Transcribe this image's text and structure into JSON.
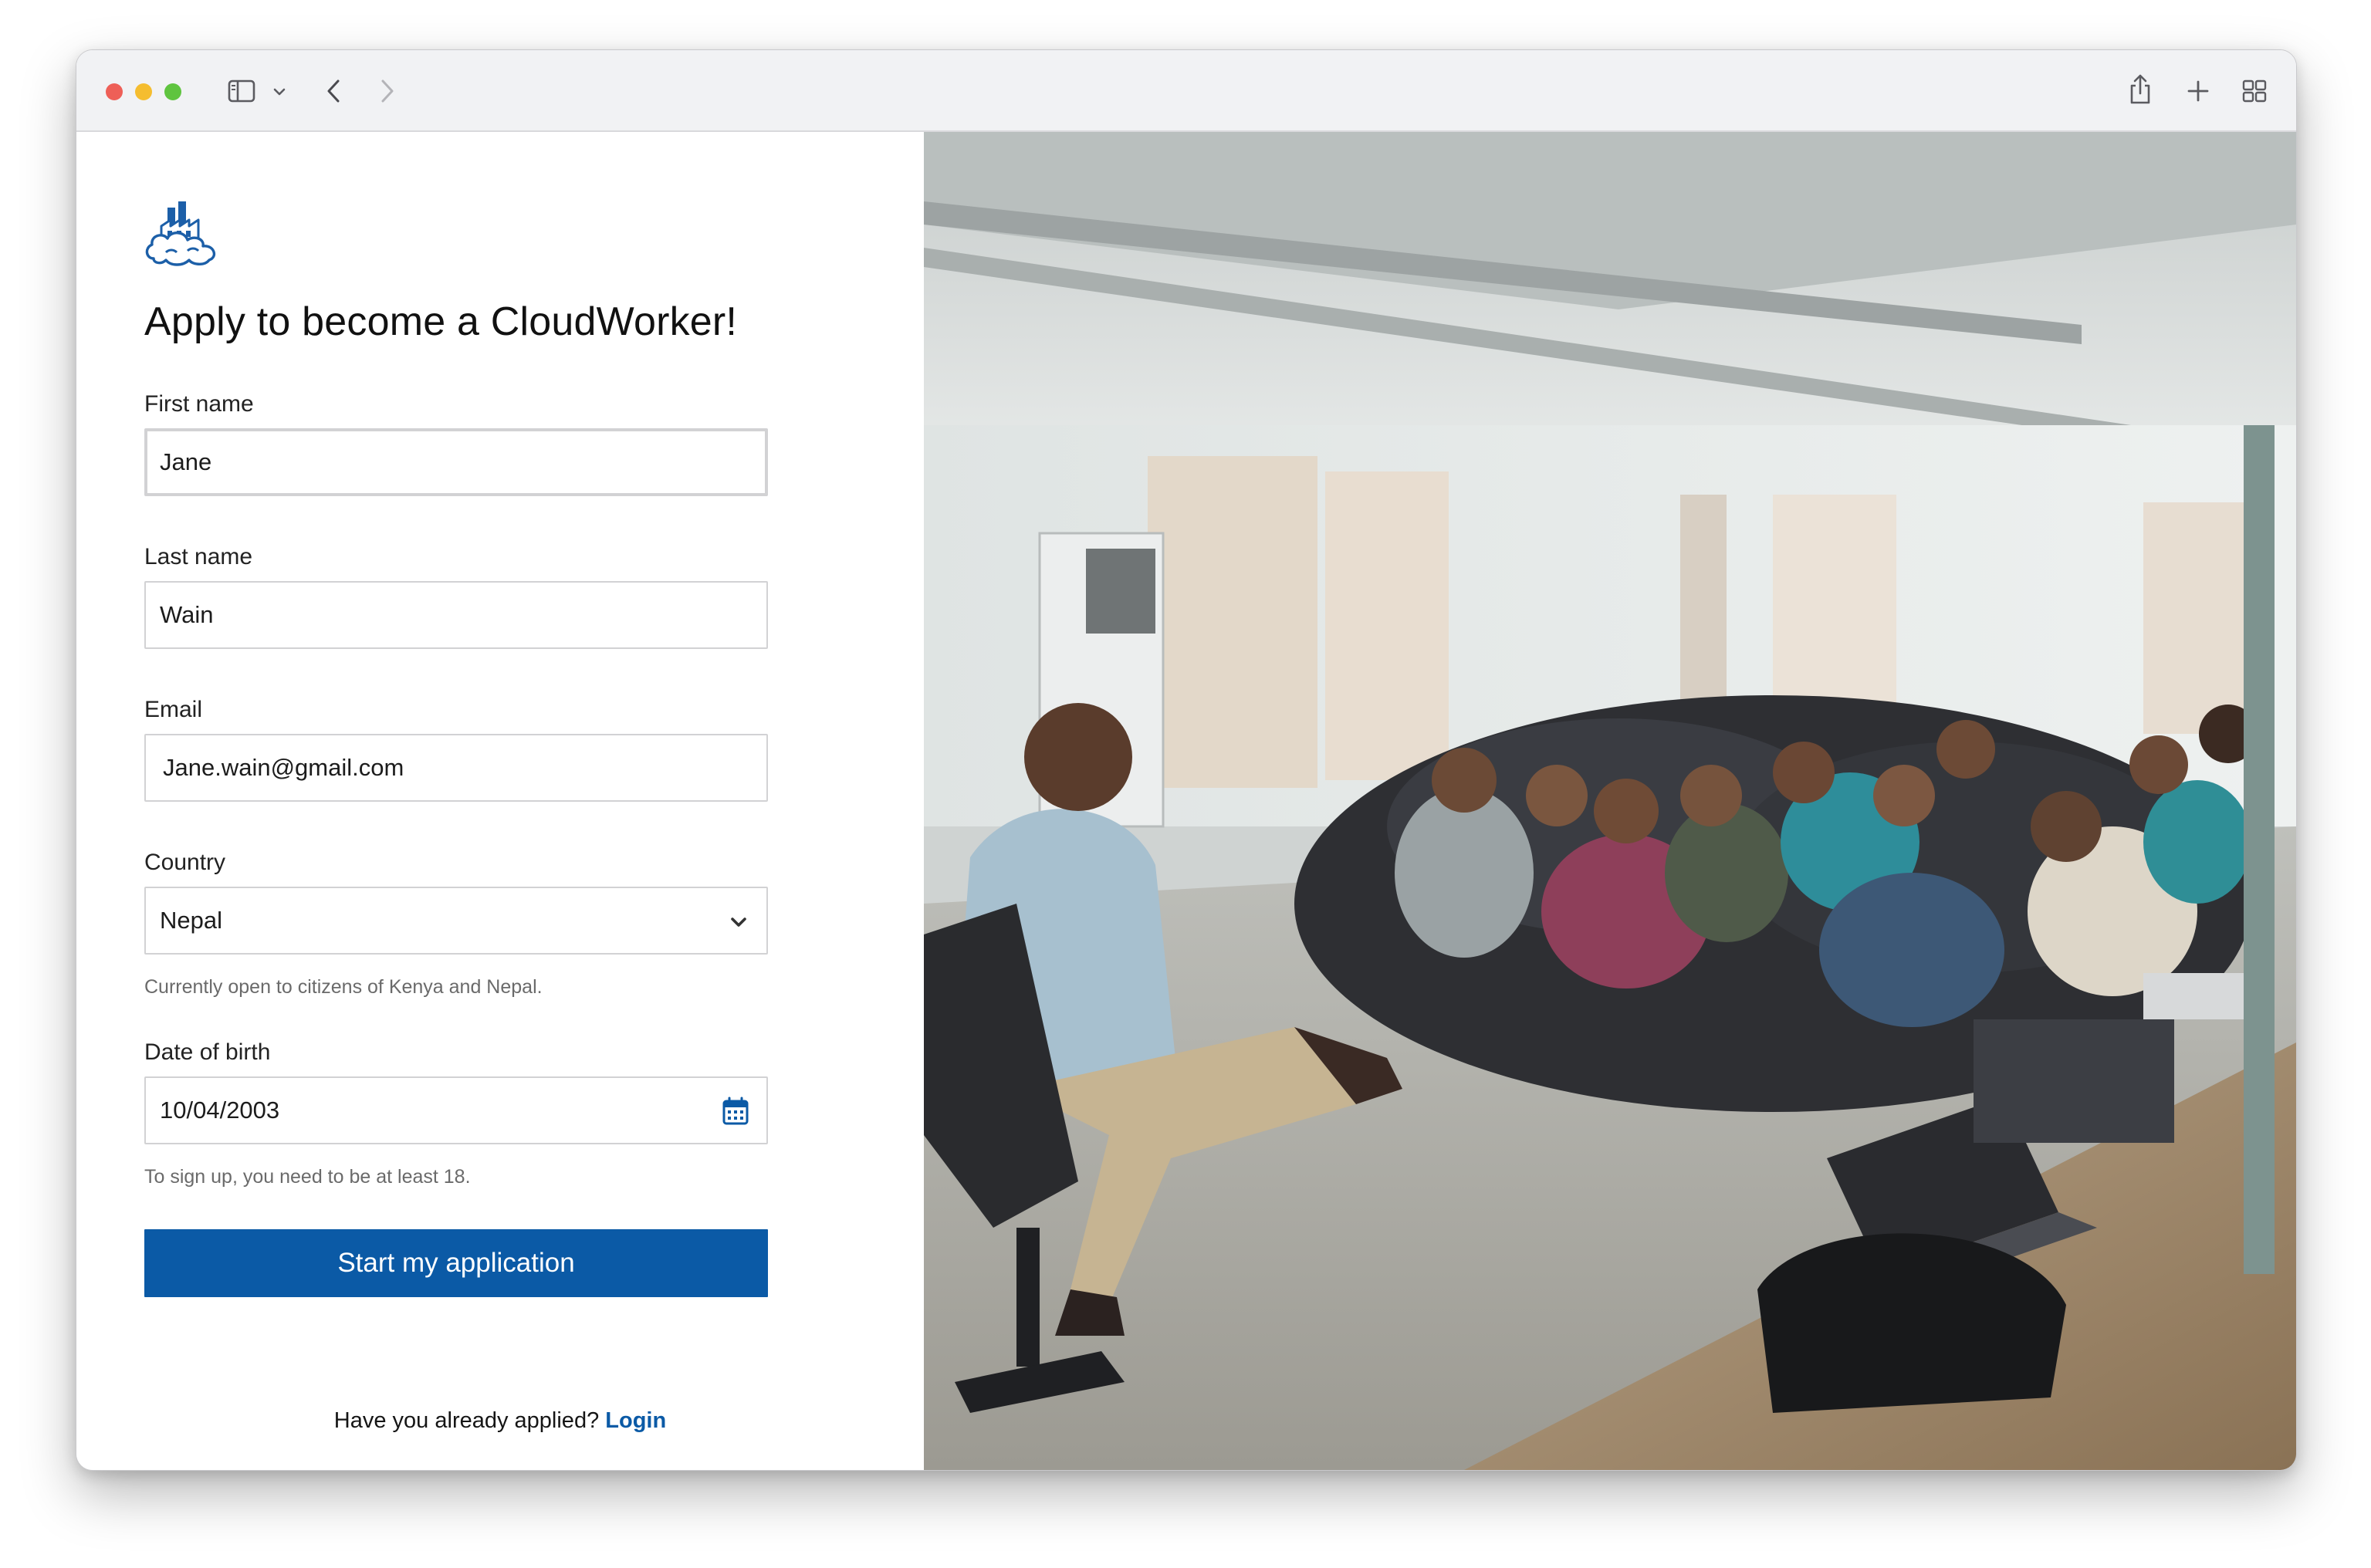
{
  "browser": {
    "toolbar_icons": [
      "sidebar-icon",
      "chevron-down-icon",
      "back-icon",
      "forward-icon",
      "share-icon",
      "new-tab-icon",
      "tab-overview-icon"
    ]
  },
  "form": {
    "heading": "Apply to become a CloudWorker!",
    "first_name": {
      "label": "First name",
      "value": "Jane"
    },
    "last_name": {
      "label": "Last name",
      "value": "Wain"
    },
    "email": {
      "label": "Email",
      "value": "Jane.wain@gmail.com"
    },
    "country": {
      "label": "Country",
      "value": "Nepal",
      "helper": "Currently open to citizens of Kenya and Nepal."
    },
    "dob": {
      "label": "Date of birth",
      "value": "10/04/2003",
      "helper": "To sign up, you need to be at least 18."
    },
    "submit_label": "Start my application",
    "login_prompt": "Have you already applied?",
    "login_link": "Login"
  },
  "colors": {
    "accent": "#0b5aa6",
    "heading": "#111111",
    "helper": "#6a6a6a",
    "border": "#d2d2d4"
  }
}
